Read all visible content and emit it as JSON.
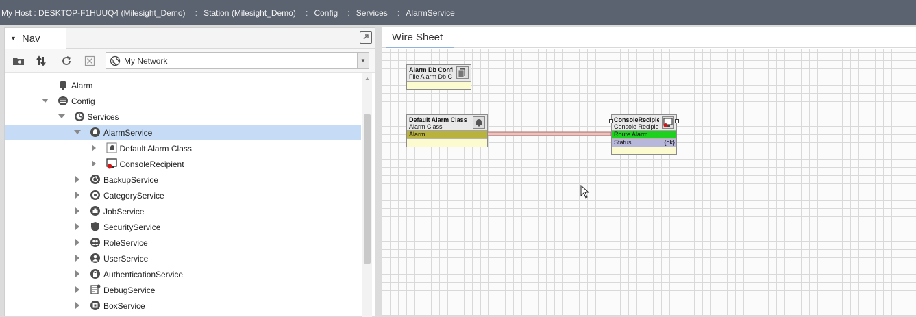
{
  "breadcrumb": [
    {
      "label": "My Host : DESKTOP-F1HUUQ4 (Milesight_Demo)"
    },
    {
      "label": "Station (Milesight_Demo)"
    },
    {
      "label": "Config"
    },
    {
      "label": "Services"
    },
    {
      "label": "AlarmService"
    }
  ],
  "nav": {
    "title": "Nav",
    "network_select": "My Network",
    "tree": [
      {
        "label": "Alarm",
        "icon": "bell-icon",
        "expander": "none",
        "selected": false
      },
      {
        "label": "Config",
        "icon": "config-icon",
        "expander": "expanded",
        "selected": false
      },
      {
        "label": "Services",
        "icon": "services-icon",
        "expander": "expanded",
        "selected": false
      },
      {
        "label": "AlarmService",
        "icon": "alarm-service-icon",
        "expander": "expanded",
        "selected": true
      },
      {
        "label": "Default Alarm Class",
        "icon": "alarm-class-icon",
        "expander": "collapsed",
        "selected": false
      },
      {
        "label": "ConsoleRecipient",
        "icon": "console-recipient-icon",
        "expander": "collapsed",
        "selected": false
      },
      {
        "label": "BackupService",
        "icon": "backup-service-icon",
        "expander": "collapsed",
        "selected": false
      },
      {
        "label": "CategoryService",
        "icon": "category-service-icon",
        "expander": "collapsed",
        "selected": false
      },
      {
        "label": "JobService",
        "icon": "job-service-icon",
        "expander": "collapsed",
        "selected": false
      },
      {
        "label": "SecurityService",
        "icon": "shield-icon",
        "expander": "collapsed",
        "selected": false
      },
      {
        "label": "RoleService",
        "icon": "role-service-icon",
        "expander": "collapsed",
        "selected": false
      },
      {
        "label": "UserService",
        "icon": "user-service-icon",
        "expander": "collapsed",
        "selected": false
      },
      {
        "label": "AuthenticationService",
        "icon": "lock-icon",
        "expander": "collapsed",
        "selected": false
      },
      {
        "label": "DebugService",
        "icon": "debug-service-icon",
        "expander": "collapsed",
        "selected": false
      },
      {
        "label": "BoxService",
        "icon": "box-service-icon",
        "expander": "collapsed",
        "selected": false
      }
    ]
  },
  "wiresheet": {
    "title": "Wire Sheet",
    "components": {
      "alarm_db": {
        "name": "Alarm Db Config",
        "type": "File Alarm Db C"
      },
      "default_alarm_class": {
        "name": "Default Alarm Class",
        "type": "Alarm Class",
        "slot": "Alarm"
      },
      "console_recipient": {
        "name": "ConsoleRecipie",
        "type": "Console Recipie",
        "slot_route": "Route Alarm",
        "slot_status": "Status",
        "status_value": "{ok}"
      }
    }
  },
  "colors": {
    "topbar": "#5b6270",
    "selection": "#c6dcf6",
    "alarm_slot": "#b9b23c",
    "route_alarm_slot": "#1fd11f",
    "status_slot": "#b7b7dc",
    "link": "#c9817b"
  }
}
